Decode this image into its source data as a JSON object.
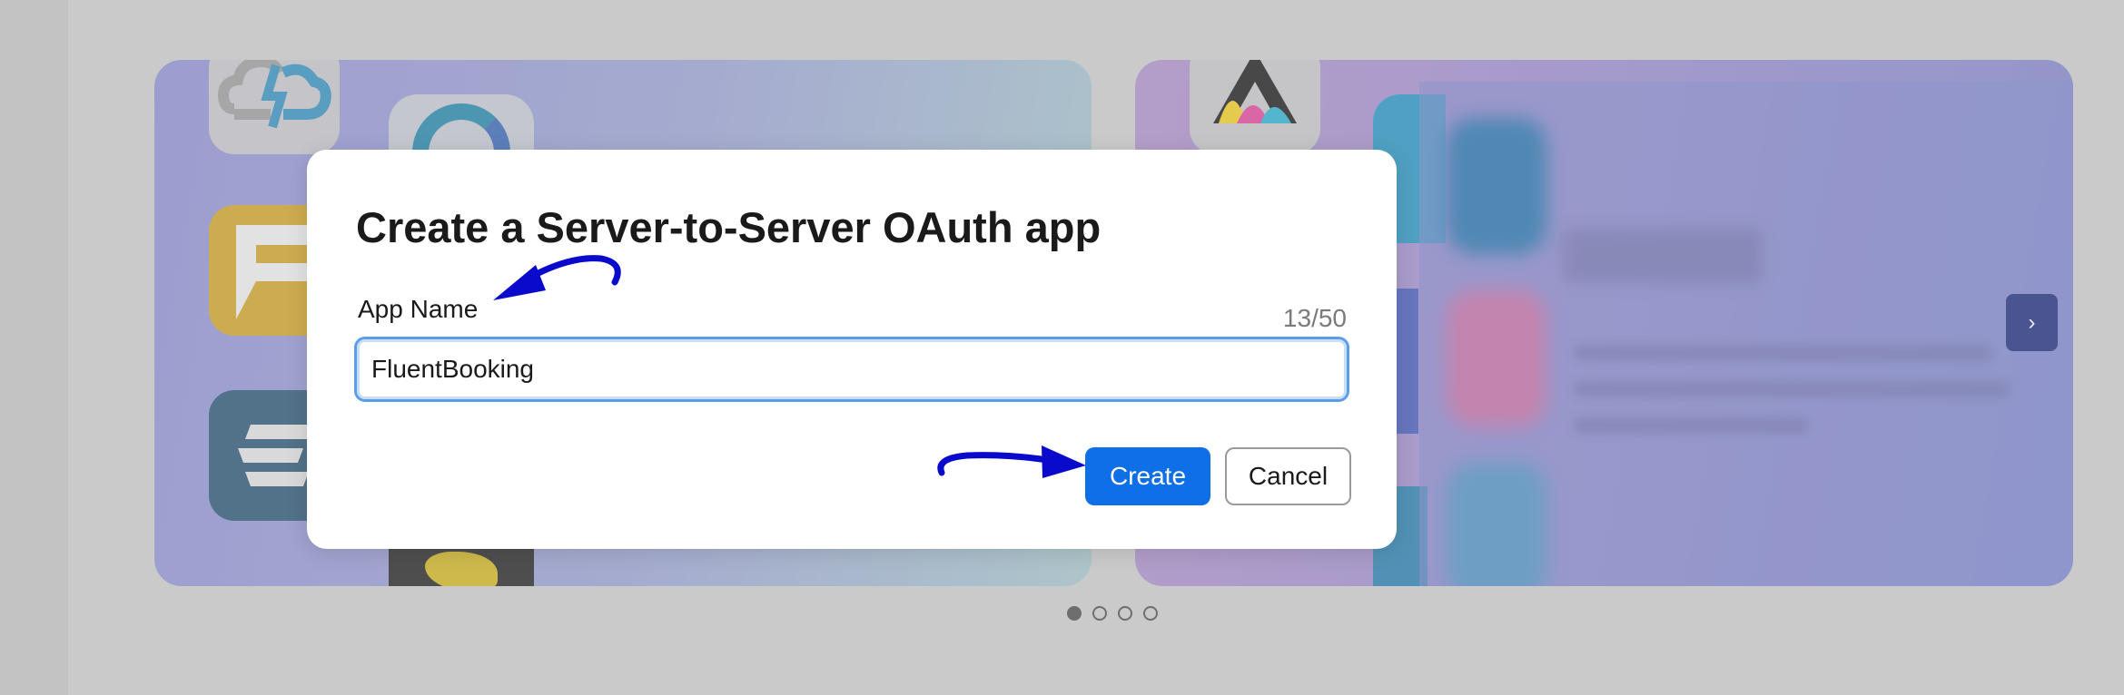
{
  "modal": {
    "title": "Create a Server-to-Server OAuth app",
    "field_label": "App Name",
    "char_counter": "13/50",
    "app_name_value": "FluentBooking",
    "create_label": "Create",
    "cancel_label": "Cancel"
  },
  "carousel": {
    "next_icon": "›",
    "dots": [
      {
        "active": true
      },
      {
        "active": false
      },
      {
        "active": false
      },
      {
        "active": false
      }
    ]
  },
  "colors": {
    "primary_button": "#0e6fe6",
    "input_focus_border": "#5b9ee8",
    "annotation_arrow": "#0a0acc"
  },
  "icons": [
    "cloud-sync-icon",
    "fluent-f-icon",
    "e-logo-icon",
    "timer-icon",
    "lion-icon",
    "anaconda-icon",
    "chevron-right-icon"
  ]
}
